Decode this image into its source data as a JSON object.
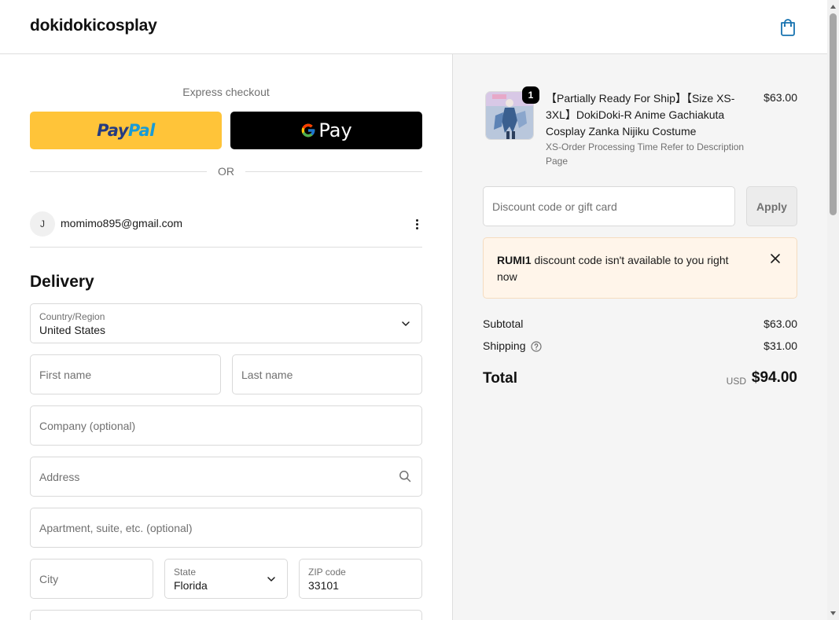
{
  "header": {
    "brand": "dokidokicosplay",
    "cart_icon": "shopping-bag-icon",
    "accent_color": "#1773b0"
  },
  "express": {
    "title": "Express checkout",
    "paypal_part1": "Pay",
    "paypal_part2": "Pal",
    "gpay_label": "Pay",
    "or_text": "OR"
  },
  "account": {
    "avatar_initial": "J",
    "email": "momimo895@gmail.com",
    "menu_icon": "more-vertical-icon"
  },
  "delivery": {
    "title": "Delivery",
    "country": {
      "label": "Country/Region",
      "value": "United States"
    },
    "first_name_placeholder": "First name",
    "last_name_placeholder": "Last name",
    "company_placeholder": "Company (optional)",
    "address_placeholder": "Address",
    "apartment_placeholder": "Apartment, suite, etc. (optional)",
    "city_placeholder": "City",
    "state": {
      "label": "State",
      "value": "Florida"
    },
    "zip": {
      "label": "ZIP code",
      "value": "33101"
    }
  },
  "order": {
    "product": {
      "title": "【Partially Ready For Ship】【Size XS-3XL】DokiDoki-R Anime Gachiakuta Cosplay Zanka Nijiku Costume",
      "variant": "XS-Order Processing Time Refer to Description Page",
      "price": "$63.00",
      "quantity": "1"
    },
    "discount_placeholder": "Discount code or gift card",
    "apply_label": "Apply",
    "notice": {
      "code": "RUMI1",
      "message": " discount code isn't available to you right now"
    },
    "subtotal_label": "Subtotal",
    "subtotal_value": "$63.00",
    "shipping_label": "Shipping",
    "shipping_value": "$31.00",
    "total_label": "Total",
    "total_currency": "USD",
    "total_value": "$94.00"
  }
}
